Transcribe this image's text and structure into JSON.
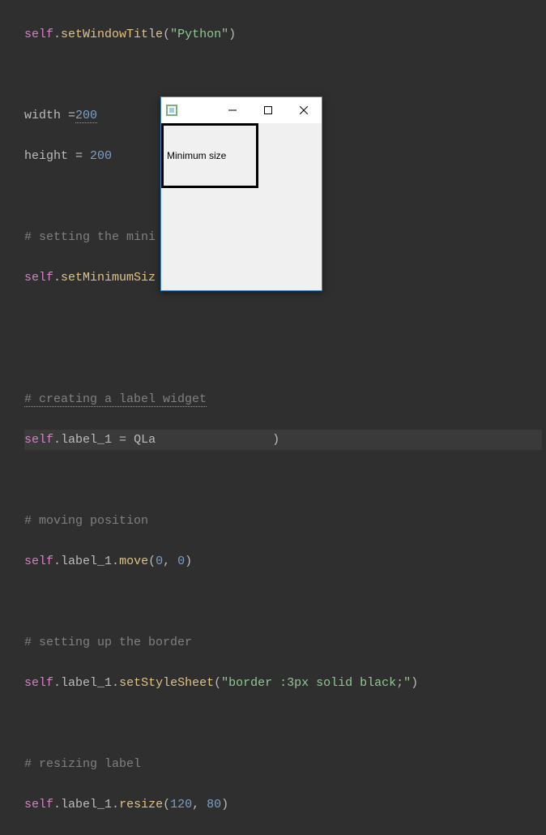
{
  "code": {
    "line1": {
      "self": "self",
      "dot": ".",
      "method": "setWindowTitle",
      "open": "(",
      "str": "\"Python\"",
      "close": ")"
    },
    "line3_a": "width ",
    "line3_op": "=",
    "line3_num": "200",
    "line4_a": "height ",
    "line4_op": "= ",
    "line4_num": "200",
    "line6_comment": "# setting the mini",
    "line7": {
      "self": "self",
      "dot": ".",
      "method": "setMinimumSiz"
    },
    "line10_comment": "# creating a label widget",
    "line11": {
      "self": "self",
      "dot1": ".",
      "prop": "label_1",
      "eq": " = ",
      "cls": "QLa",
      "close": ")"
    },
    "line13_comment": "# moving position",
    "line14": {
      "self": "self",
      "dot1": ".",
      "prop": "label_1",
      "dot2": ".",
      "method": "move",
      "open": "(",
      "a": "0",
      "comma": ", ",
      "b": "0",
      "close": ")"
    },
    "line16_comment": "# setting up the border",
    "line17": {
      "self": "self",
      "dot1": ".",
      "prop": "label_1",
      "dot2": ".",
      "method": "setStyleSheet",
      "open": "(",
      "str": "\"border :3px solid black;\"",
      "close": ")"
    },
    "line19_comment": "# resizing label",
    "line20": {
      "self": "self",
      "dot1": ".",
      "prop": "label_1",
      "dot2": ".",
      "method": "resize",
      "open": "(",
      "a": "120",
      "comma": ", ",
      "b": "80",
      "close": ")"
    }
  },
  "window": {
    "label_text": "Minimum size"
  }
}
